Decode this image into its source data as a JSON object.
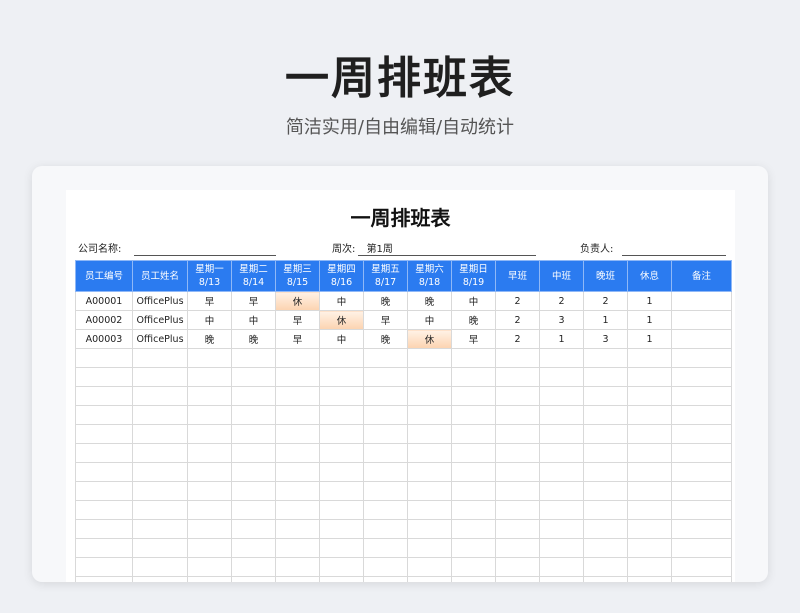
{
  "hero": {
    "title": "一周排班表",
    "subtitle": "简洁实用/自由编辑/自动统计"
  },
  "sheet": {
    "title": "一周排班表",
    "company_label": "公司名称:",
    "week_label": "周次:",
    "week_value": "第1周",
    "owner_label": "负责人:"
  },
  "table": {
    "headers": [
      {
        "l1": "员工编号",
        "l2": ""
      },
      {
        "l1": "员工姓名",
        "l2": ""
      },
      {
        "l1": "星期一",
        "l2": "8/13"
      },
      {
        "l1": "星期二",
        "l2": "8/14"
      },
      {
        "l1": "星期三",
        "l2": "8/15"
      },
      {
        "l1": "星期四",
        "l2": "8/16"
      },
      {
        "l1": "星期五",
        "l2": "8/17"
      },
      {
        "l1": "星期六",
        "l2": "8/18"
      },
      {
        "l1": "星期日",
        "l2": "8/19"
      },
      {
        "l1": "早班",
        "l2": ""
      },
      {
        "l1": "中班",
        "l2": ""
      },
      {
        "l1": "晚班",
        "l2": ""
      },
      {
        "l1": "休息",
        "l2": ""
      },
      {
        "l1": "备注",
        "l2": ""
      }
    ],
    "rows": [
      [
        "A00001",
        "OfficePlus",
        "早",
        "早",
        "休",
        "中",
        "晚",
        "晚",
        "中",
        "2",
        "2",
        "2",
        "1",
        ""
      ],
      [
        "A00002",
        "OfficePlus",
        "中",
        "中",
        "早",
        "休",
        "早",
        "中",
        "晚",
        "2",
        "3",
        "1",
        "1",
        ""
      ],
      [
        "A00003",
        "OfficePlus",
        "晚",
        "晚",
        "早",
        "中",
        "晚",
        "休",
        "早",
        "2",
        "1",
        "3",
        "1",
        ""
      ]
    ],
    "off_marker": "休",
    "header_color": "#2b7bf0",
    "off_color": "#fcd3b0"
  }
}
